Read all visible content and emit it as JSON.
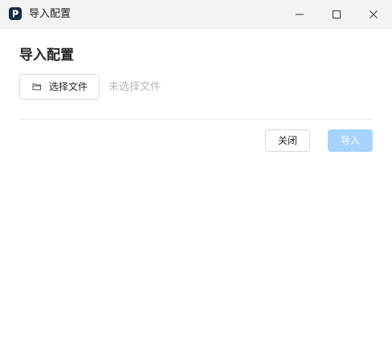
{
  "window": {
    "title": "导入配置",
    "controls": [
      "minimize-icon",
      "maximize-icon",
      "close-icon"
    ]
  },
  "dialog": {
    "heading": "导入配置",
    "file_button_label": "选择文件",
    "file_button_icon": "folder-icon",
    "file_status": "未选择文件"
  },
  "footer": {
    "close_label": "关闭",
    "import_label": "导入"
  },
  "colors": {
    "titlebar_bg": "#f3f3f3",
    "primary_disabled": "#a6d2ff",
    "placeholder_text": "#b8b8b8",
    "app_icon_bg": "#1a2b45"
  }
}
